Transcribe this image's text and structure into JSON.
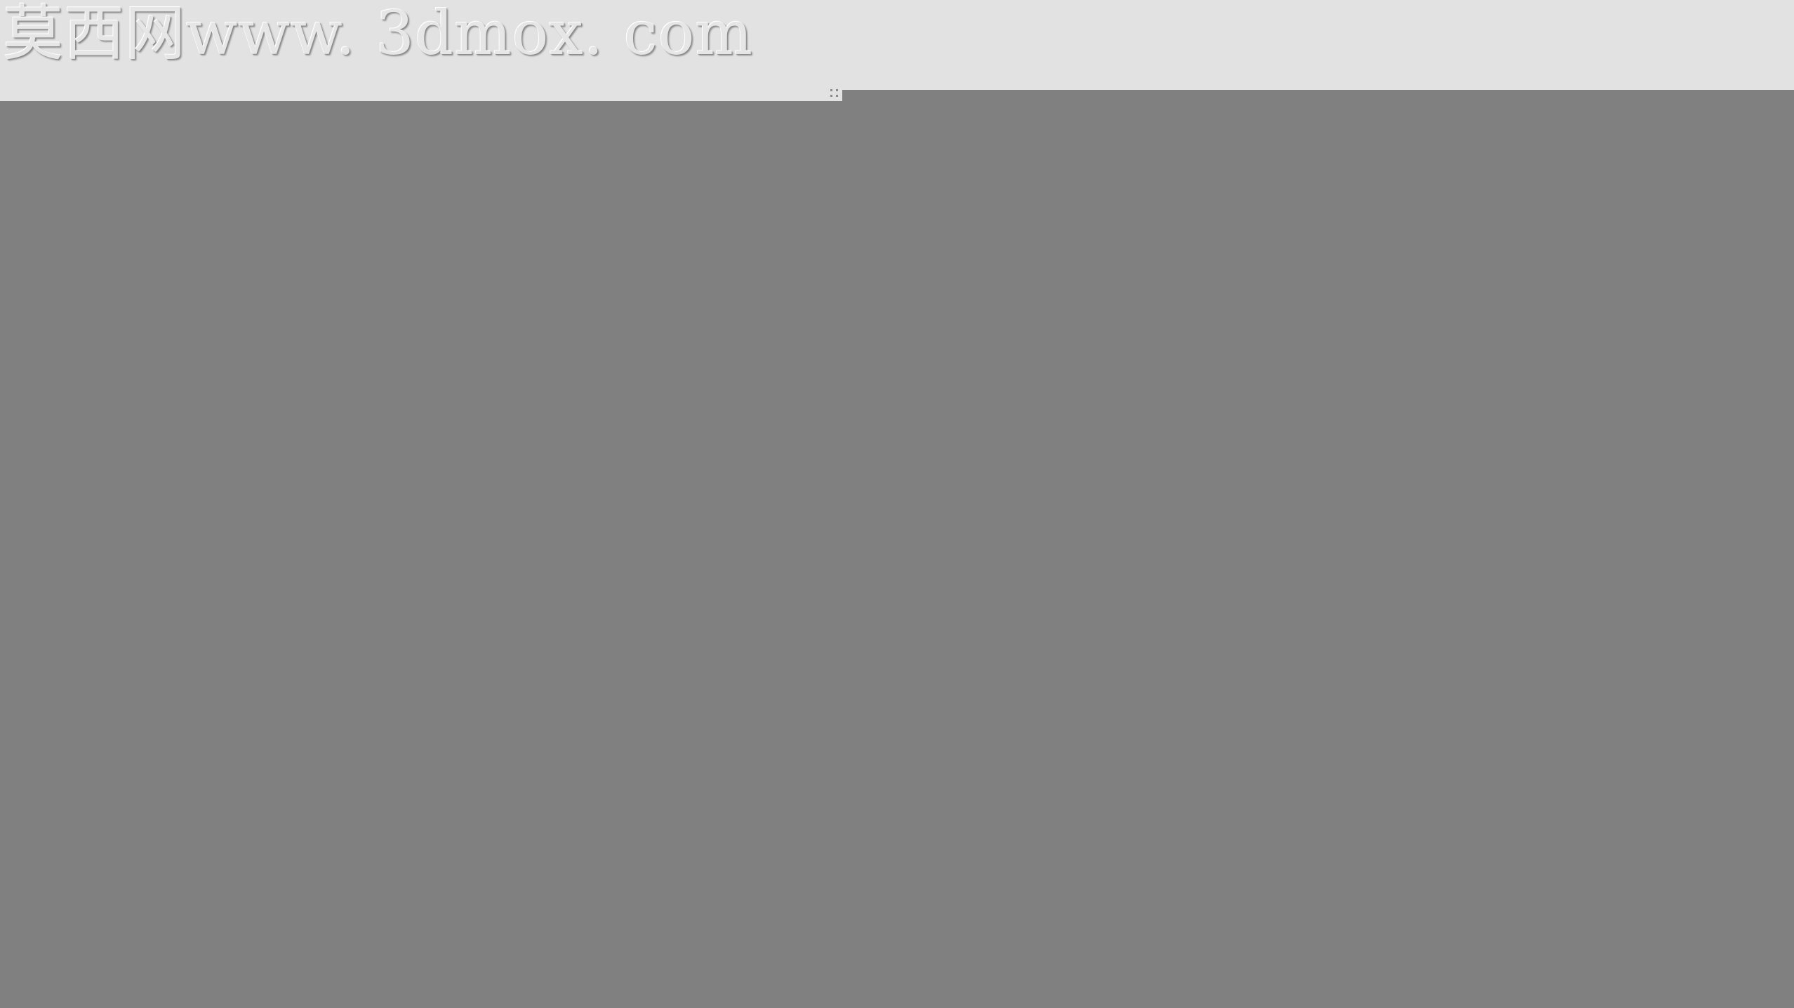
{
  "watermark": {
    "text": "莫西网www. 3dmox. com"
  },
  "canvas": {
    "background_color": "#808080"
  },
  "header": {
    "background_color": "#e2e2e2"
  },
  "resize_handle": {
    "icon": "grip-icon"
  }
}
